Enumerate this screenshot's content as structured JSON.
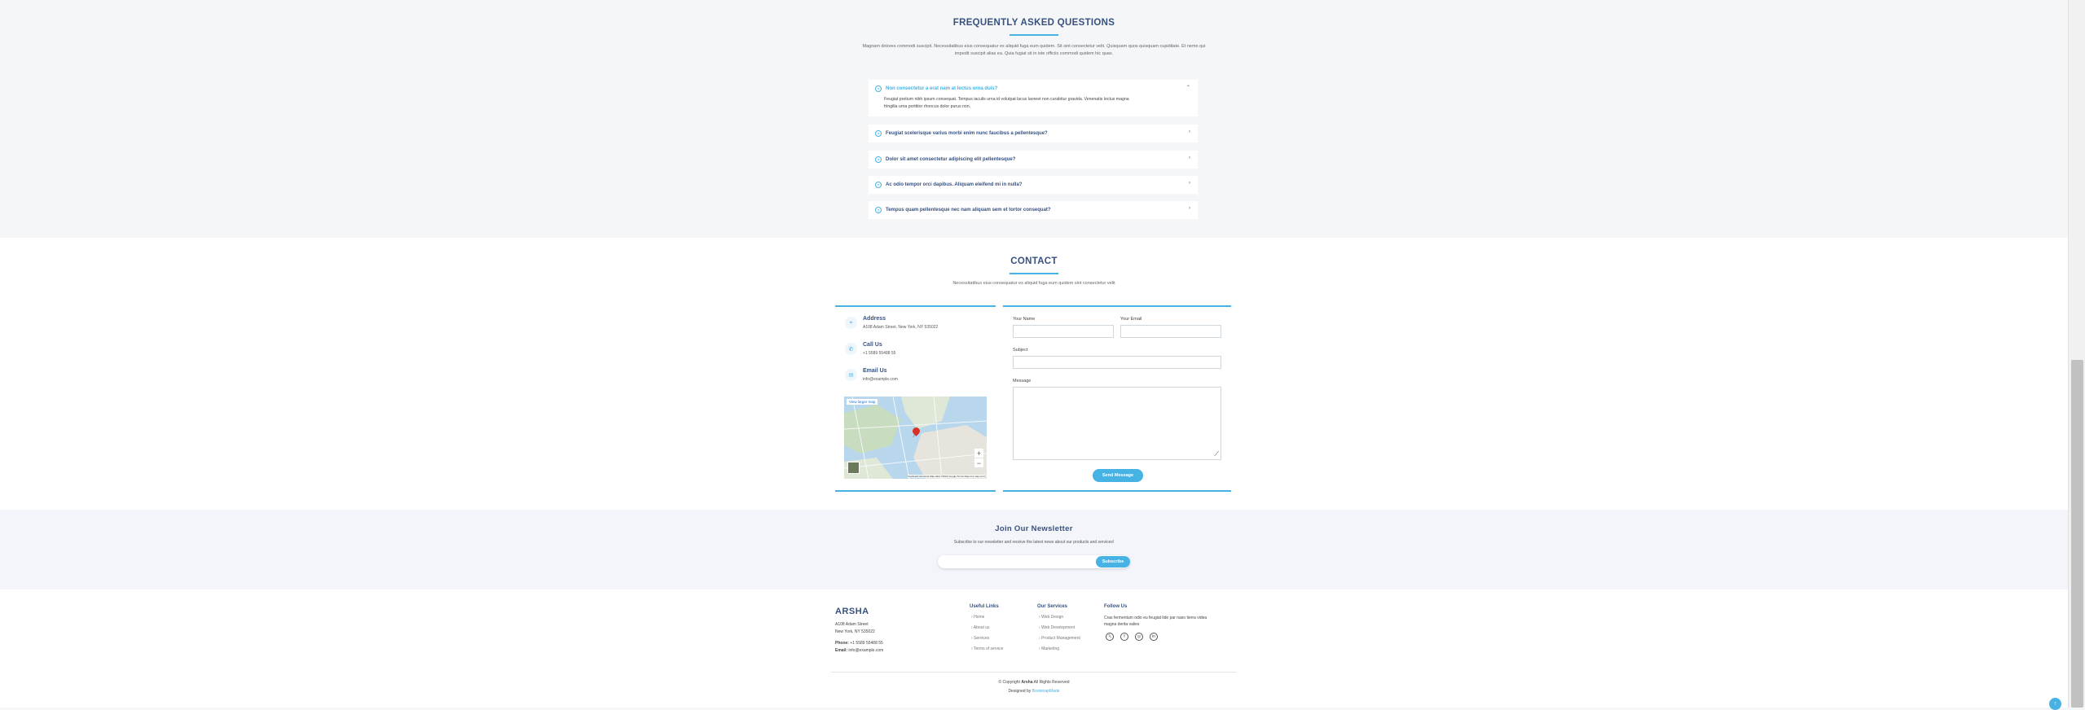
{
  "faq": {
    "title": "FREQUENTLY ASKED QUESTIONS",
    "intro_line1": "Magnam dolores commodi suscipit. Necessitatibus eius consequatur ex aliquid fuga eum quidem. Sit sint consectetur velit. Quisquam quos quisquam cupiditate. Et nemo qui",
    "intro_line2": "impedit suscipit alias ea. Quia fugiat sit in iste officiis commodi quidem hic quas.",
    "items": [
      {
        "question": "Non consectetur a erat nam at lectus urna duis?",
        "answer_line1": "Feugiat pretium nibh ipsum consequat. Tempus iaculis urna id volutpat lacus laoreet non curabitur gravida. Venenatis lectus magna",
        "answer_line2": "fringilla urna porttitor rhoncus dolor purus non."
      },
      {
        "question": "Feugiat scelerisque varius morbi enim nunc faucibus a pellentesque?"
      },
      {
        "question": "Dolor sit amet consectetur adipiscing elit pellentesque?"
      },
      {
        "question": "Ac odio tempor orci dapibus. Aliquam eleifend mi in nulla?"
      },
      {
        "question": "Tempus quam pellentesque nec nam aliquam sem et tortor consequat?"
      }
    ]
  },
  "contact": {
    "title": "CONTACT",
    "intro": "Necessitatibus eius consequatur ex aliquid fuga eum quidem sint consectetur velit",
    "address_label": "Address",
    "address_value": "A108 Adam Street, New York, NY 535022",
    "call_label": "Call Us",
    "call_value": "+1 5589 55488 55",
    "email_label": "Email Us",
    "email_value": "info@example.com",
    "map_link": "View larger map",
    "map_footer": "Keyboard shortcuts   Map data ©2024 Google   Terms   Report a map error",
    "form": {
      "name_label": "Your Name",
      "email_label": "Your Email",
      "subject_label": "Subject",
      "message_label": "Message",
      "submit": "Send Message"
    }
  },
  "newsletter": {
    "title": "Join Our Newsletter",
    "subtitle": "Subscribe to our newsletter and receive the latest news about our products and services!",
    "button": "Subscribe"
  },
  "footer": {
    "brand": "ARSHA",
    "address1": "A108 Adam Street",
    "address2": "New York, NY 535022",
    "phone_label": "Phone:",
    "phone_value": "+1 5589 55488 55",
    "email_label": "Email:",
    "email_value": "info@example.com",
    "useful_title": "Useful Links",
    "useful_links": [
      "Home",
      "About us",
      "Services",
      "Terms of service"
    ],
    "services_title": "Our Services",
    "services_links": [
      "Web Design",
      "Web Development",
      "Product Management",
      "Marketing"
    ],
    "follow_title": "Follow Us",
    "follow_text1": "Cras fermentum odio eu feugiat lide par naso tierra videa",
    "follow_text2": "magna derita valies",
    "copyright_prefix": "© Copyright",
    "copyright_brand": "Arsha",
    "copyright_suffix": "All Rights Reserved",
    "designed_prefix": "Designed by",
    "designed_by": "BootstrapMade"
  },
  "colors": {
    "accent": "#47b2e4",
    "heading": "#37517e"
  }
}
